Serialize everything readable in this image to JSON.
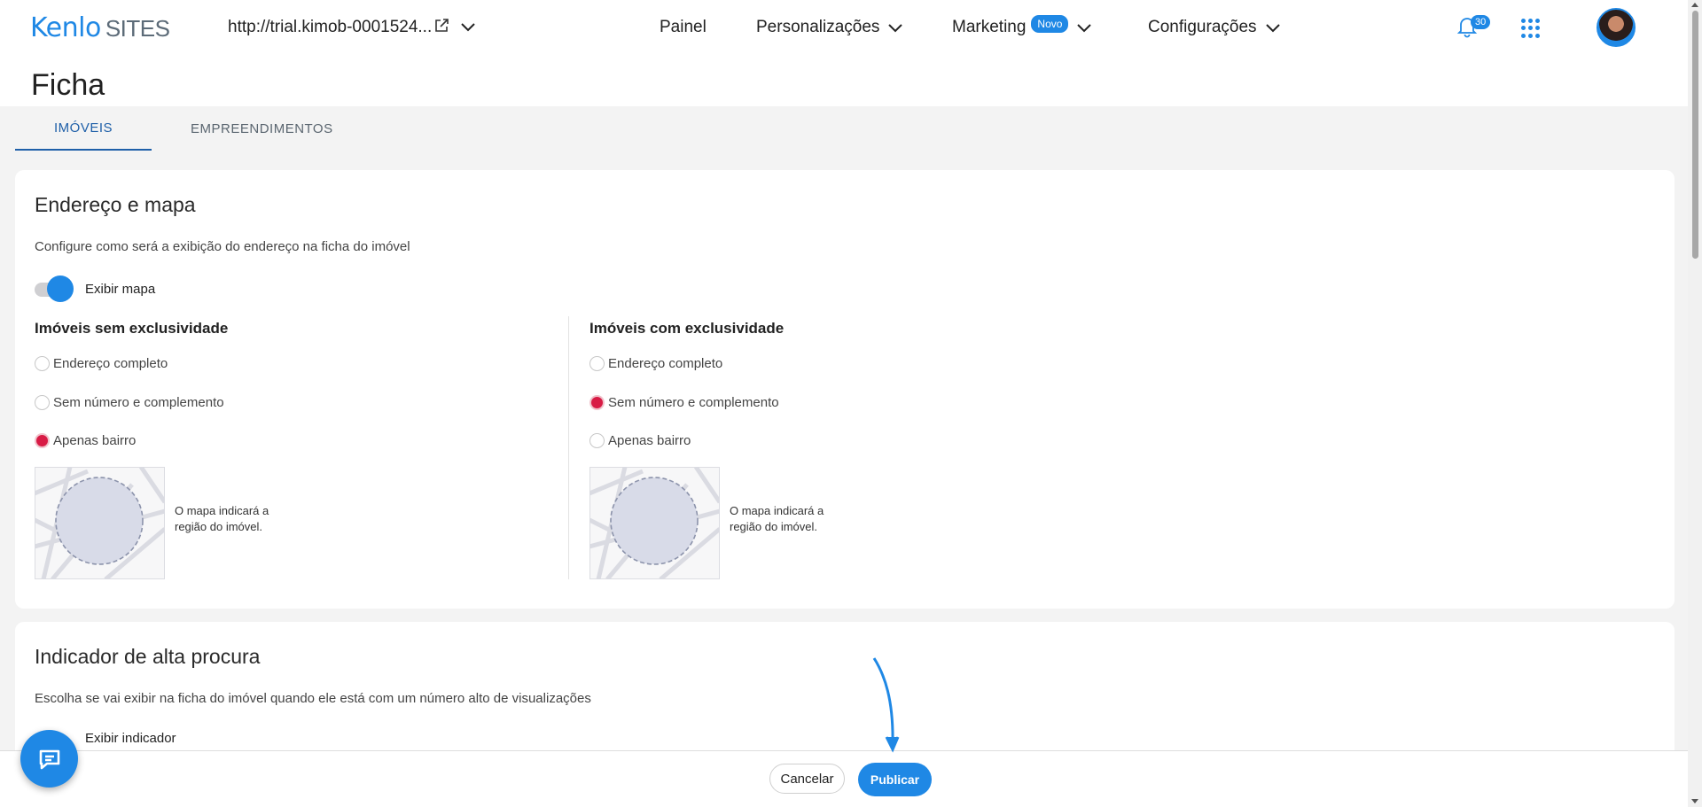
{
  "header": {
    "logo_primary": "Kenlo",
    "logo_secondary": "SITES",
    "site_url": "http://trial.kimob-0001524...",
    "nav": [
      {
        "label": "Painel"
      },
      {
        "label": "Personalizações"
      },
      {
        "label": "Marketing",
        "badge": "Novo"
      },
      {
        "label": "Configurações"
      }
    ],
    "notification_count": "30",
    "icons": {
      "external": "external-link-icon",
      "chevron": "chevron-down-icon",
      "bell": "bell-icon",
      "apps": "apps-grid-icon"
    }
  },
  "page": {
    "title": "Ficha",
    "tabs": [
      {
        "label": "IMÓVEIS",
        "active": true
      },
      {
        "label": "EMPREENDIMENTOS",
        "active": false
      }
    ]
  },
  "address_card": {
    "title": "Endereço e mapa",
    "description": "Configure como será a exibição do endereço na ficha do imóvel",
    "toggle_label": "Exibir mapa",
    "toggle_on": true,
    "columns": [
      {
        "heading": "Imóveis sem exclusividade",
        "options": [
          "Endereço completo",
          "Sem número e complemento",
          "Apenas bairro"
        ],
        "selected": "Apenas bairro",
        "map_note": "O mapa indicará a região do imóvel."
      },
      {
        "heading": "Imóveis com exclusividade",
        "options": [
          "Endereço completo",
          "Sem número e complemento",
          "Apenas bairro"
        ],
        "selected": "Sem número e complemento",
        "map_note": "O mapa indicará a região do imóvel."
      }
    ]
  },
  "demand_card": {
    "title": "Indicador de alta procura",
    "description": "Escolha se vai exibir na ficha do imóvel quando ele está com um número alto de visualizações",
    "toggle_label": "Exibir indicador"
  },
  "actions": {
    "cancel": "Cancelar",
    "publish": "Publicar"
  },
  "colors": {
    "accent": "#1f88e5",
    "tab_active": "#1e5fa8",
    "radio_selected": "#d81b45"
  }
}
